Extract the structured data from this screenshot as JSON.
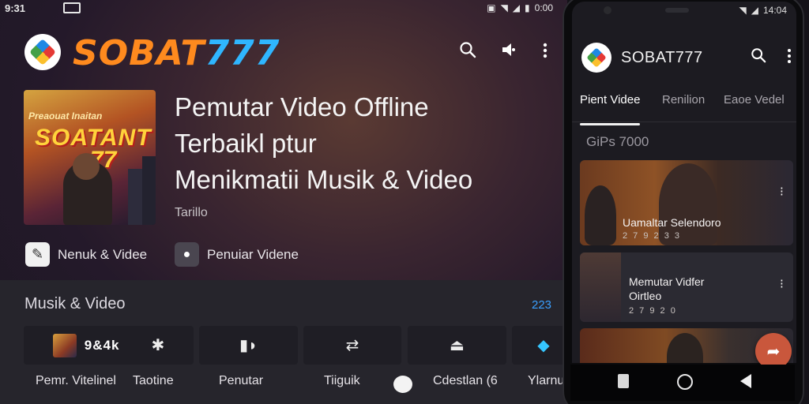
{
  "status": {
    "time": "9:31",
    "right_text": "0:00"
  },
  "header": {
    "brand_part1": "SOBAT",
    "brand_part2": "777"
  },
  "hero": {
    "poster": {
      "line1": "Preaouat Inaitan",
      "line2": "SOATANT",
      "line3": "77"
    },
    "title_lines": [
      "Pemutar Video Offline",
      "Terbaikl ptur",
      "Menikmatii Musik & Video"
    ],
    "subtitle": "Tarillo",
    "actions": [
      {
        "label": "Nenuk & Videe",
        "icon": "pencil-icon"
      },
      {
        "label": "Penuiar Videne",
        "icon": "chat-icon"
      }
    ]
  },
  "section": {
    "title": "Musik & Video",
    "count": "223",
    "tiles": [
      {
        "text": "9&4k",
        "icon": "thumbnail-image",
        "caption": "Pemr. Vitelinel"
      },
      {
        "text": "",
        "icon": "puzzle-icon",
        "caption": "Taotine"
      },
      {
        "text": "",
        "icon": "media-icon",
        "caption": "Penutar"
      },
      {
        "text": "",
        "icon": "sync-icon",
        "caption": "Tiiguik"
      },
      {
        "text": "",
        "icon": "eject-icon",
        "caption": "Cdestlan (6"
      },
      {
        "text": "",
        "icon": "chat-bubble-icon",
        "caption": "Ylarnu"
      }
    ]
  },
  "phone": {
    "status_text": "14:04",
    "brand": "SOBAT777",
    "tabs": [
      "Pient Videe",
      "Renilion",
      "Eaoe Vedel"
    ],
    "active_tab": 0,
    "sort_label": "GiPs 7000",
    "videos": [
      {
        "title": "Uamaltar Selendoro",
        "meta": "2 7 9 2 3 3"
      },
      {
        "title": "Memutar Vidfer\nOirtleo",
        "meta": "2 7 9 2 0"
      },
      {
        "title": "",
        "meta": ""
      }
    ]
  },
  "colors": {
    "brand_orange": "#ff8a1e",
    "brand_blue": "#2fb6ff",
    "accent_blue": "#3aa0ff",
    "fab": "#c9573c"
  }
}
